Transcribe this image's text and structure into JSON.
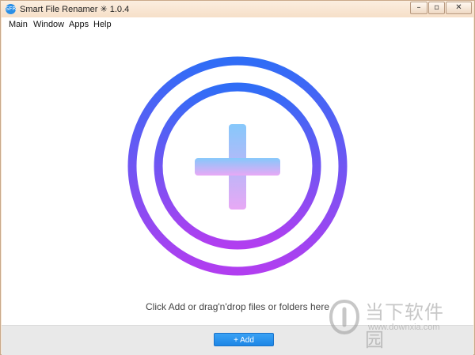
{
  "window": {
    "title": "Smart File Renamer ✳ 1.0.4",
    "app_icon_text": "SFR",
    "controls": {
      "minimize": "–",
      "restore": "▫",
      "close": "✕"
    }
  },
  "menu": {
    "items": [
      "Main",
      "Window",
      "Apps",
      "Help"
    ]
  },
  "drop_zone": {
    "hint": "Click Add or drag'n'drop files or folders here"
  },
  "footer": {
    "add_label": "+ Add"
  },
  "watermark": {
    "text": "当下软件园",
    "url": "www.downxia.com"
  },
  "colors": {
    "ring_top": "#2f6df6",
    "ring_bottom": "#b13ef0",
    "plus_top": "#86c8fb",
    "plus_bottom": "#e8a8f5",
    "button": "#2a93ee"
  }
}
